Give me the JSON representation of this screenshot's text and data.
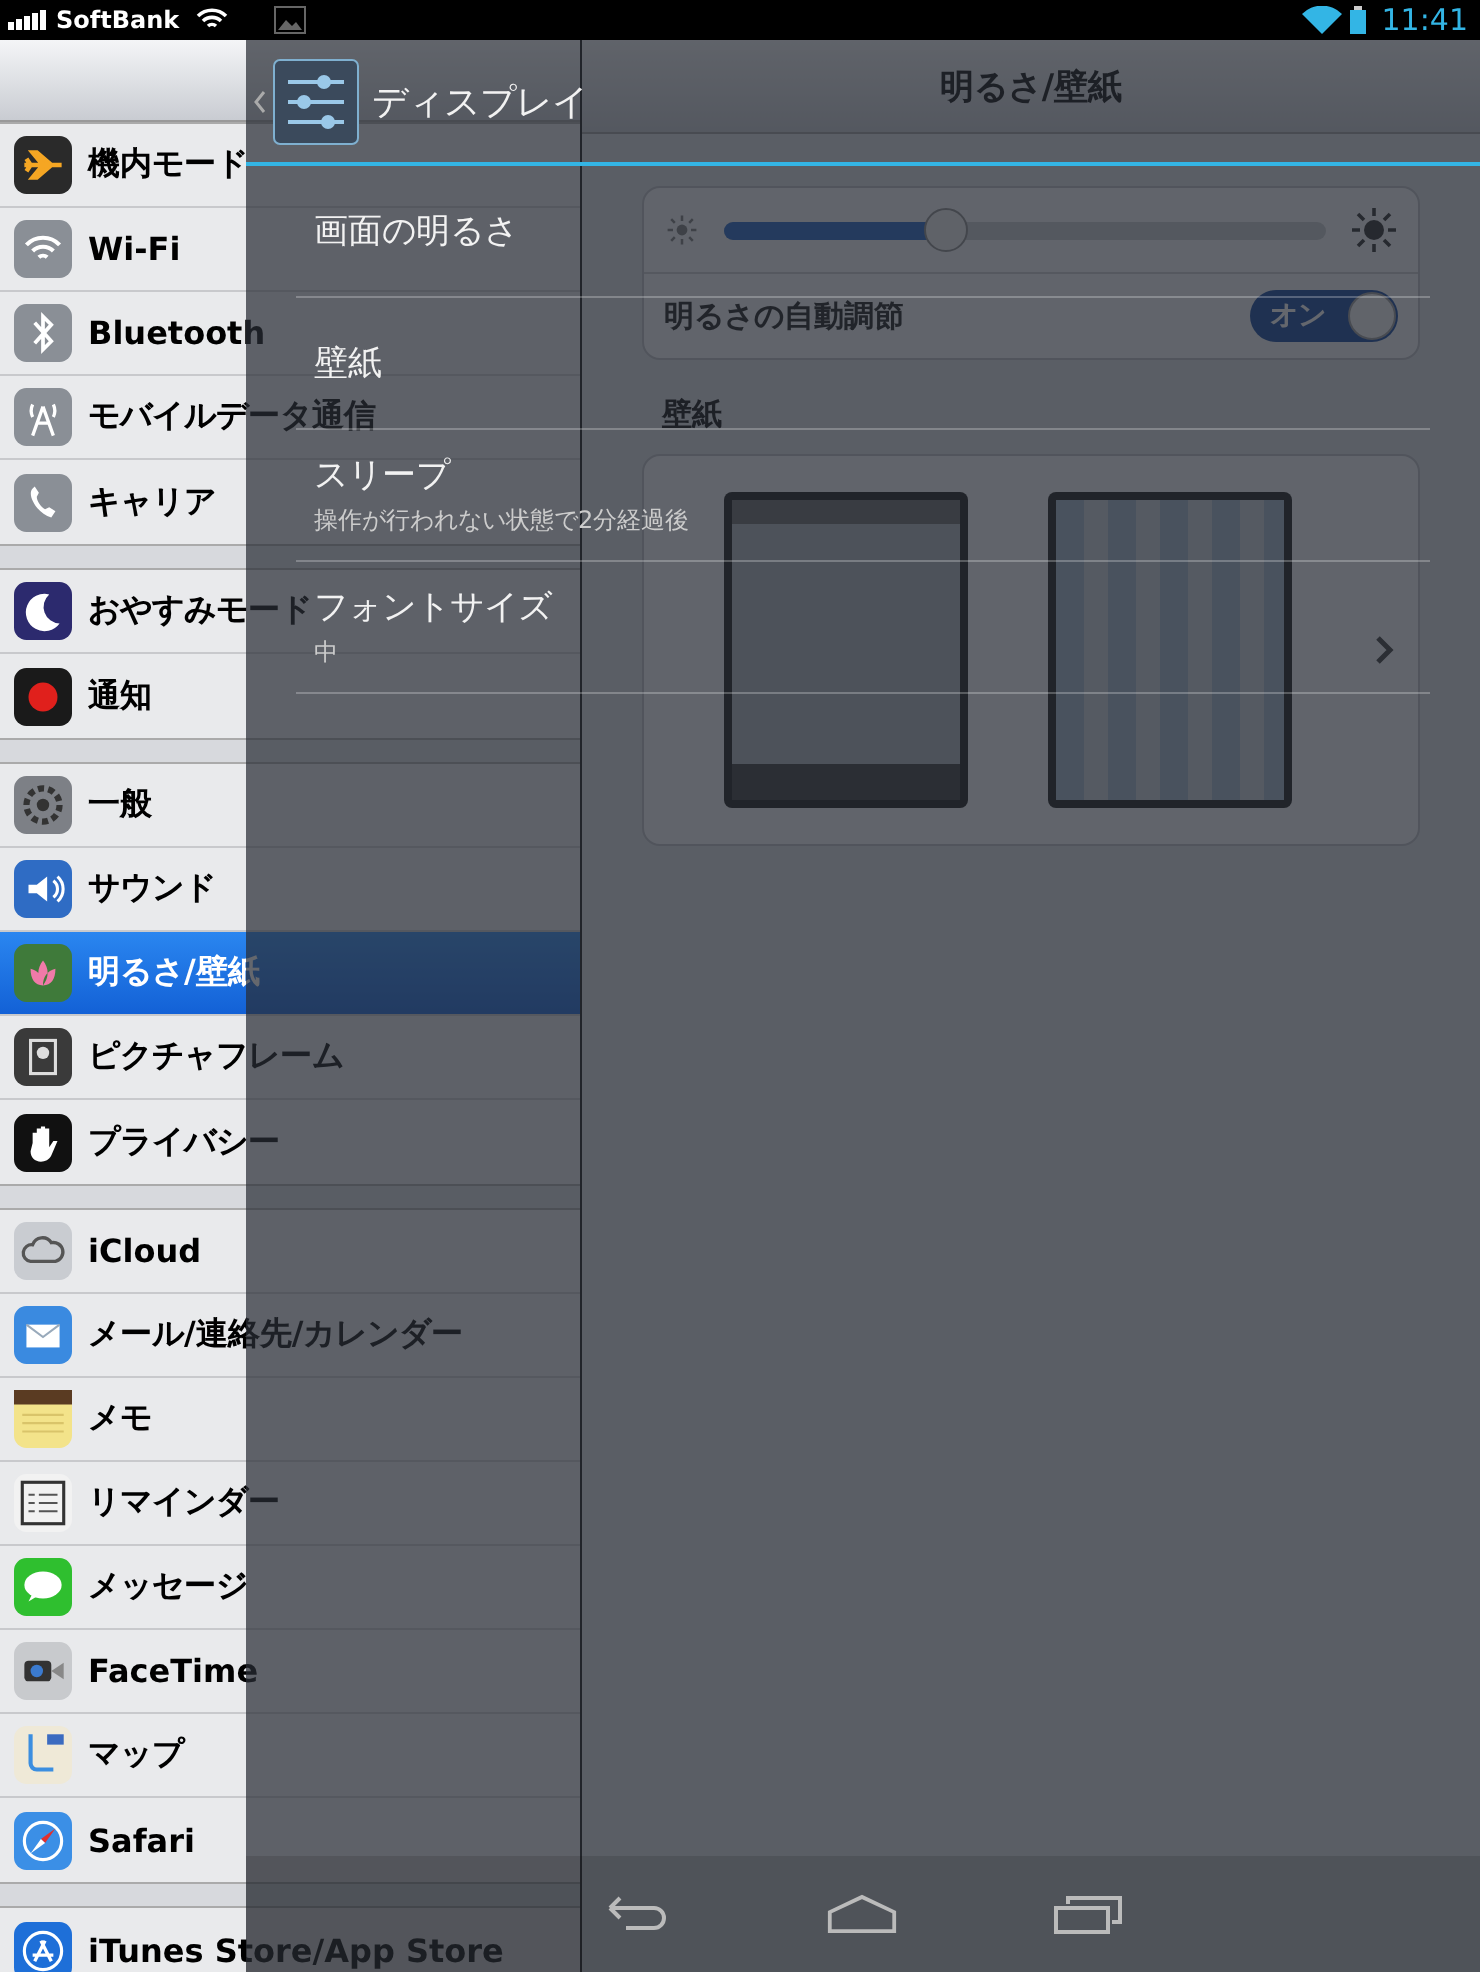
{
  "status_bar": {
    "carrier": "SoftBank",
    "overlay_time": "11:41"
  },
  "sidebar": {
    "groups": [
      {
        "items": [
          {
            "label": "機内モード",
            "selected": false
          },
          {
            "label": "Wi-Fi",
            "selected": false
          },
          {
            "label": "Bluetooth",
            "selected": false
          },
          {
            "label": "モバイルデータ通信",
            "selected": false
          },
          {
            "label": "キャリア",
            "selected": false
          }
        ]
      },
      {
        "items": [
          {
            "label": "おやすみモード",
            "selected": false
          },
          {
            "label": "通知",
            "selected": false
          }
        ]
      },
      {
        "items": [
          {
            "label": "一般",
            "selected": false
          },
          {
            "label": "サウンド",
            "selected": false
          },
          {
            "label": "明るさ/壁紙",
            "selected": true
          },
          {
            "label": "ピクチャフレーム",
            "selected": false
          },
          {
            "label": "プライバシー",
            "selected": false
          }
        ]
      },
      {
        "items": [
          {
            "label": "iCloud",
            "selected": false
          },
          {
            "label": "メール/連絡先/カレンダー",
            "selected": false
          },
          {
            "label": "メモ",
            "selected": false
          },
          {
            "label": "リマインダー",
            "selected": false
          },
          {
            "label": "メッセージ",
            "selected": false
          },
          {
            "label": "FaceTime",
            "selected": false
          },
          {
            "label": "マップ",
            "selected": false
          },
          {
            "label": "Safari",
            "selected": false
          }
        ]
      },
      {
        "items": [
          {
            "label": "iTunes Store/App Store",
            "selected": false
          }
        ]
      }
    ]
  },
  "detail": {
    "title": "明るさ/壁紙",
    "brightness": {
      "level": 0.37
    },
    "auto_brightness": {
      "label": "明るさの自動調節",
      "on": true,
      "toggle_text": "オン"
    },
    "wallpaper_section": "壁紙"
  },
  "overlay": {
    "title": "ディスプレイ",
    "items": [
      {
        "title": "画面の明るさ"
      },
      {
        "title": "壁紙"
      },
      {
        "title": "スリープ",
        "summary": "操作が行われない状態で2分経過後"
      },
      {
        "title": "フォントサイズ",
        "summary": "中"
      }
    ]
  }
}
